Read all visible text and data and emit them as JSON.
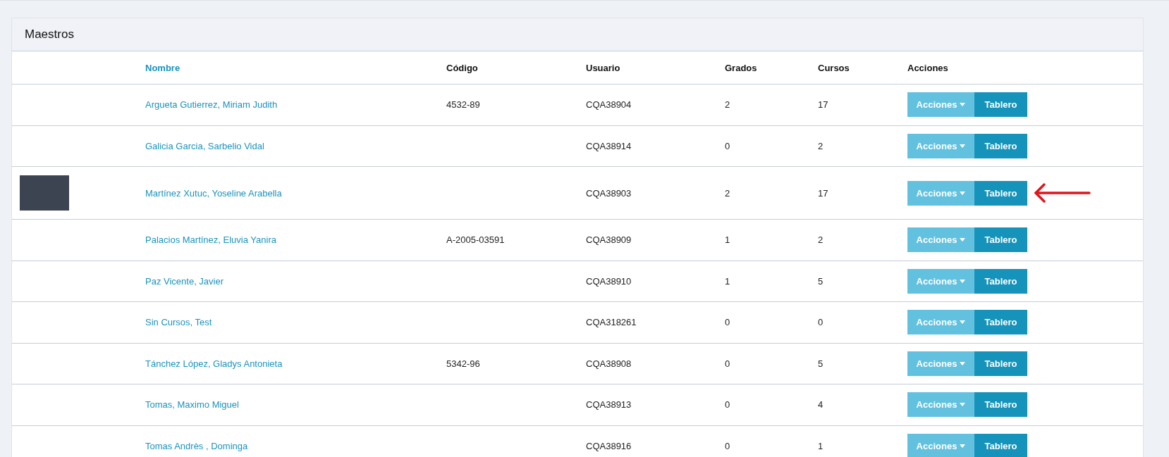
{
  "panel": {
    "title": "Maestros"
  },
  "table": {
    "columns": [
      {
        "label": "Nombre",
        "sortable": true
      },
      {
        "label": "Código",
        "sortable": false
      },
      {
        "label": "Usuario",
        "sortable": false
      },
      {
        "label": "Grados",
        "sortable": false
      },
      {
        "label": "Cursos",
        "sortable": false
      },
      {
        "label": "Acciones",
        "sortable": false
      }
    ],
    "rows": [
      {
        "photo": false,
        "name": "Argueta Gutierrez, Miriam Judith",
        "code": "4532-89",
        "user": "CQA38904",
        "grades": "2",
        "courses": "17",
        "actions": "Acciones",
        "dashboard": "Tablero",
        "arrow": false
      },
      {
        "photo": false,
        "name": "Galicia Garcia, Sarbelio Vidal",
        "code": "",
        "user": "CQA38914",
        "grades": "0",
        "courses": "2",
        "actions": "Acciones",
        "dashboard": "Tablero",
        "arrow": false
      },
      {
        "photo": true,
        "name": "Martínez Xutuc, Yoseline Arabella",
        "code": "",
        "user": "CQA38903",
        "grades": "2",
        "courses": "17",
        "actions": "Acciones",
        "dashboard": "Tablero",
        "arrow": true
      },
      {
        "photo": false,
        "name": "Palacios Martínez, Eluvia Yanira",
        "code": "A-2005-03591",
        "user": "CQA38909",
        "grades": "1",
        "courses": "2",
        "actions": "Acciones",
        "dashboard": "Tablero",
        "arrow": false
      },
      {
        "photo": false,
        "name": "Paz Vicente, Javier",
        "code": "",
        "user": "CQA38910",
        "grades": "1",
        "courses": "5",
        "actions": "Acciones",
        "dashboard": "Tablero",
        "arrow": false
      },
      {
        "photo": false,
        "name": "Sin Cursos, Test",
        "code": "",
        "user": "CQA318261",
        "grades": "0",
        "courses": "0",
        "actions": "Acciones",
        "dashboard": "Tablero",
        "arrow": false
      },
      {
        "photo": false,
        "name": "Tánchez López, Gladys Antonieta",
        "code": "5342-96",
        "user": "CQA38908",
        "grades": "0",
        "courses": "5",
        "actions": "Acciones",
        "dashboard": "Tablero",
        "arrow": false
      },
      {
        "photo": false,
        "name": "Tomas, Maximo Miguel",
        "code": "",
        "user": "CQA38913",
        "grades": "0",
        "courses": "4",
        "actions": "Acciones",
        "dashboard": "Tablero",
        "arrow": false
      },
      {
        "photo": false,
        "name": "Tomas Andrès , Dominga",
        "code": "",
        "user": "CQA38916",
        "grades": "0",
        "courses": "1",
        "actions": "Acciones",
        "dashboard": "Tablero",
        "arrow": false
      }
    ]
  }
}
